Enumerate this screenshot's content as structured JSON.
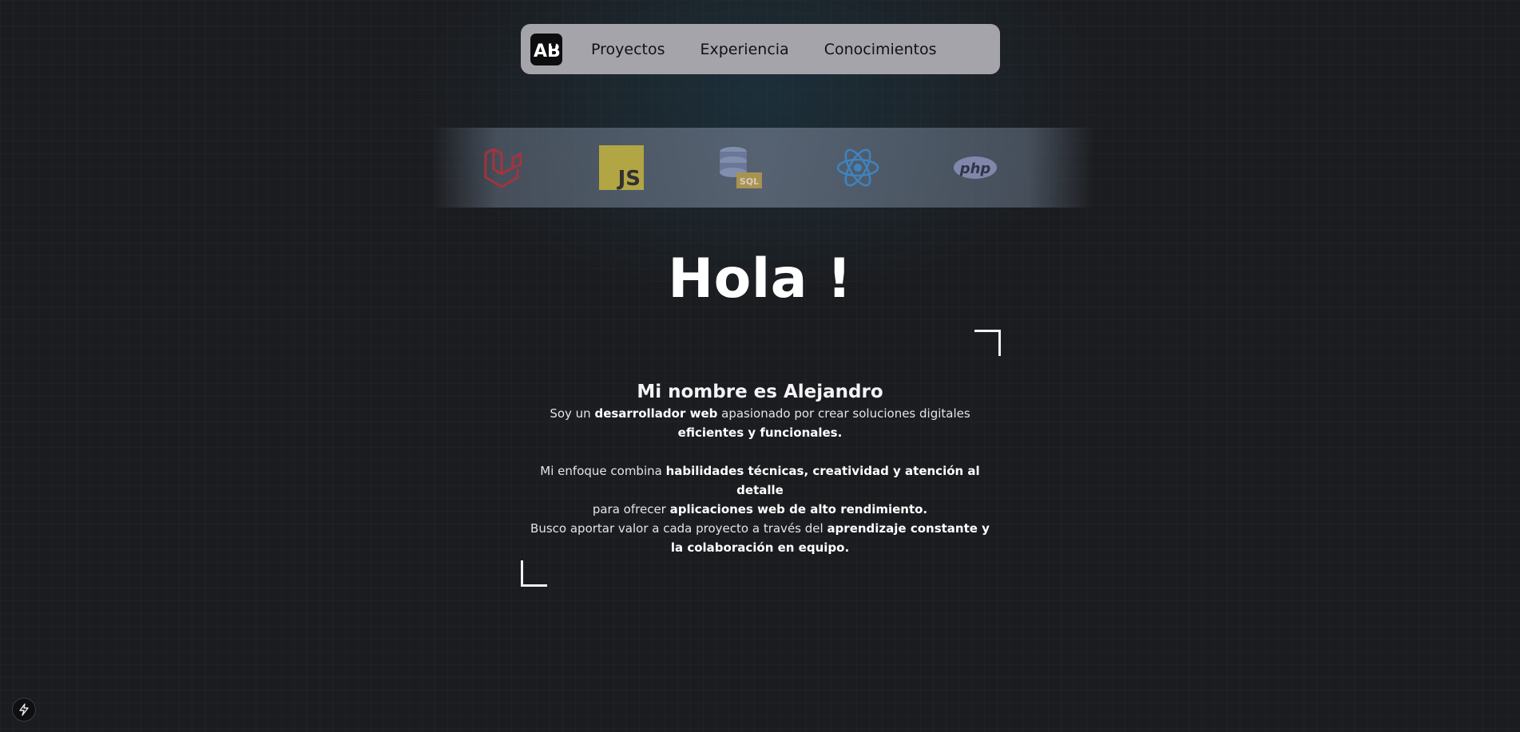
{
  "nav": {
    "logo_text": "AB",
    "links": [
      "Proyectos",
      "Experiencia",
      "Conocimientos"
    ]
  },
  "tech_icons": [
    {
      "name": "laravel-icon",
      "color": "#c0392b"
    },
    {
      "name": "javascript-icon",
      "color": "#c9b53a",
      "label": "JS"
    },
    {
      "name": "sql-database-icon",
      "color": "#7f8db0",
      "label": "SQL"
    },
    {
      "name": "react-icon",
      "color": "#3f8fd6"
    },
    {
      "name": "php-icon",
      "color": "#8c93bd",
      "label": "php"
    }
  ],
  "hero": {
    "greeting": "Hola !",
    "name_line": "Mi nombre es Alejandro",
    "p1": {
      "t1": "Soy un ",
      "b1": "desarrollador web",
      "t2": " apasionado por crear soluciones digitales ",
      "b2": "eficientes y funcionales."
    },
    "p2": {
      "t1": "Mi enfoque combina ",
      "b1": "habilidades técnicas, creatividad y atención al detalle",
      "t2": " para ofrecer ",
      "b2": "aplicaciones web de alto rendimiento.",
      "t3": "Busco aportar valor a cada proyecto a través del ",
      "b3": "aprendizaje constante y la colaboración en equipo."
    }
  },
  "badge": {
    "icon": "lightning-icon"
  }
}
